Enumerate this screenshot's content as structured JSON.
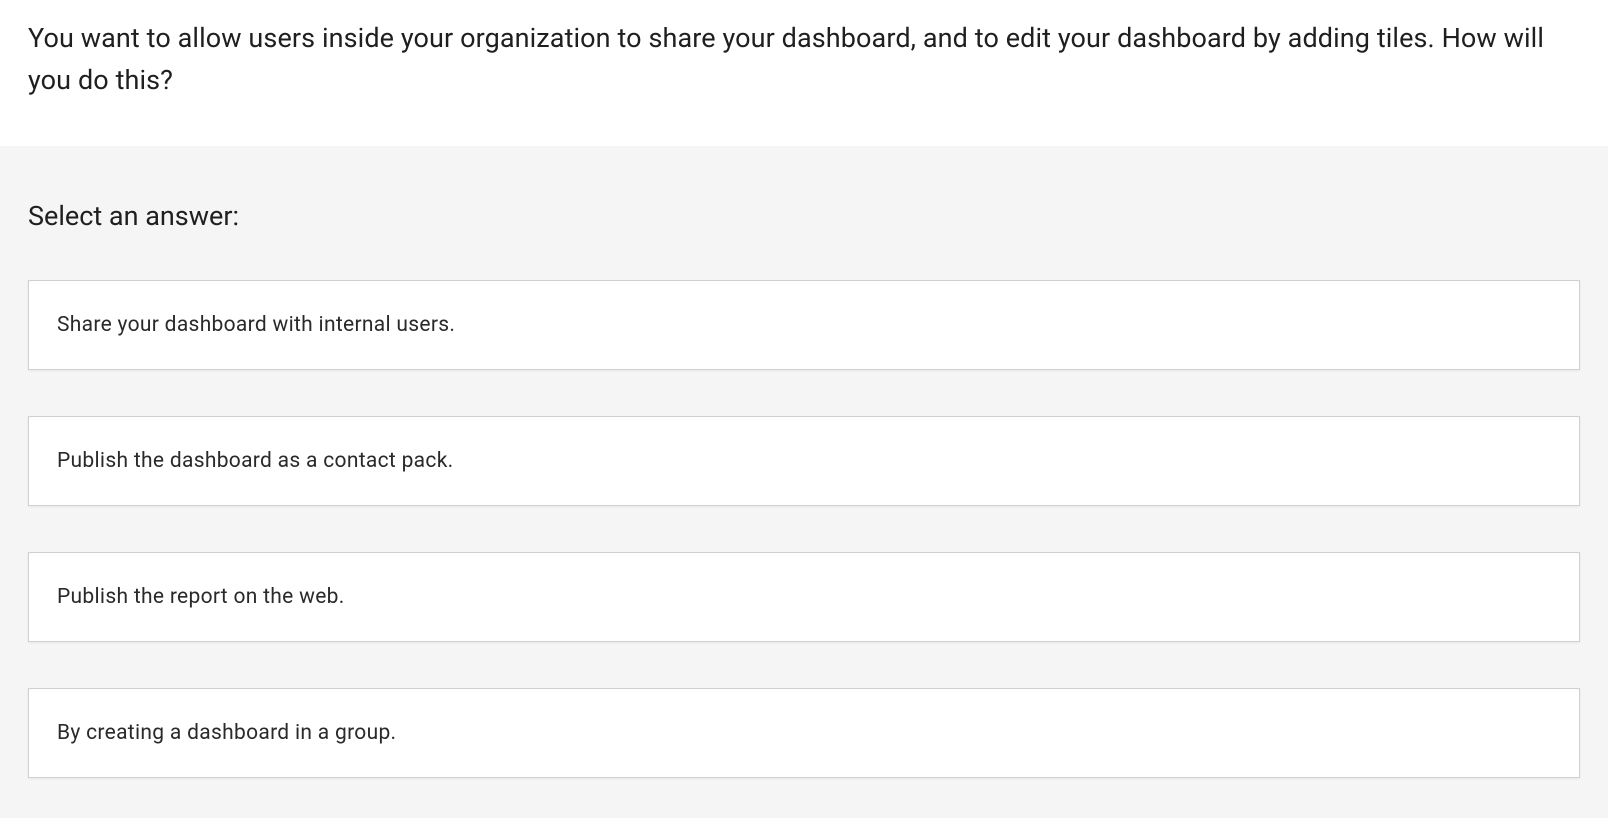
{
  "question": {
    "text": "You want to allow users inside your organization to share your dashboard, and to edit your dashboard by adding tiles. How will you do this?"
  },
  "answer": {
    "prompt": "Select an answer:",
    "options": [
      {
        "label": "Share your dashboard with internal users."
      },
      {
        "label": "Publish the dashboard as a contact pack."
      },
      {
        "label": "Publish the report on the web."
      },
      {
        "label": "By creating a dashboard in a group."
      }
    ]
  }
}
